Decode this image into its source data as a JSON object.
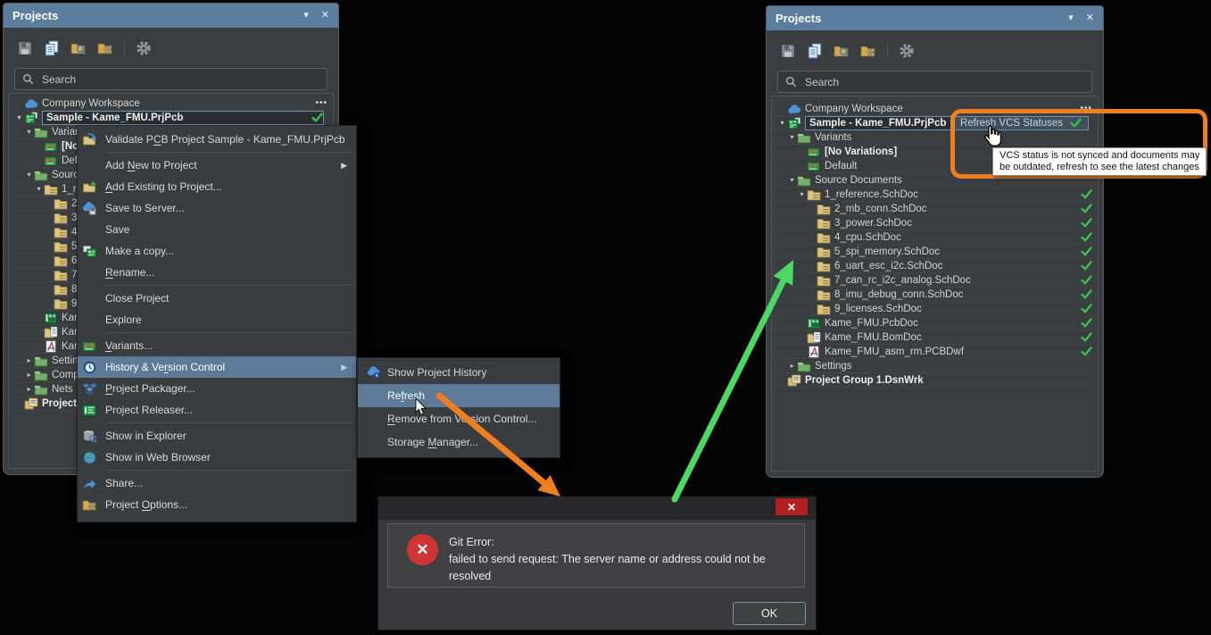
{
  "ui": {
    "collapse_glyph": "▾",
    "close_glyph": "✕",
    "submenu_arrow": "▶",
    "ellipsis": "•••",
    "tree_open": "▾",
    "tree_closed": "▸"
  },
  "colors": {
    "titlebar": "#5b7e9e",
    "panel_bg": "#3b3e40",
    "menu_highlight": "#5d7b99",
    "callout_orange": "#ee7f21",
    "arrow_green": "#4bd964",
    "check_green": "#35c24a",
    "error_red": "#cf3535"
  },
  "toolbar_icons": [
    "save",
    "copy",
    "folder-search",
    "folder-settings",
    "gear"
  ],
  "panel_left": {
    "title": "Projects",
    "search_placeholder": "Search",
    "rows": [
      {
        "label": "Company Workspace",
        "icon": "cloud",
        "indent": 0,
        "ellipsis": true
      },
      {
        "label": "Sample - Kame_FMU.PrjPcb",
        "icon": "prjpcb",
        "indent": 0,
        "expand": "open",
        "bold": true,
        "selected": true,
        "check": true
      },
      {
        "label": "Variants",
        "icon": "folder",
        "indent": 1,
        "expand": "open"
      },
      {
        "label": "[No Variations]",
        "icon": "variant",
        "indent": 2,
        "bold": true
      },
      {
        "label": "Default",
        "icon": "variant",
        "indent": 2
      },
      {
        "label": "Source Documents",
        "icon": "folder",
        "indent": 1,
        "expand": "open"
      },
      {
        "label": "1_reference.SchDoc",
        "icon": "schdoc",
        "indent": 2,
        "expand": "open",
        "check": true
      },
      {
        "label": "2_mb_conn.SchDoc",
        "icon": "schdoc",
        "indent": 3,
        "check": true
      },
      {
        "label": "3_power.SchDoc",
        "icon": "schdoc",
        "indent": 3,
        "check": true
      },
      {
        "label": "4_cpu.SchDoc",
        "icon": "schdoc",
        "indent": 3,
        "check": true
      },
      {
        "label": "5_spi_memory.SchDoc",
        "icon": "schdoc",
        "indent": 3,
        "check": true
      },
      {
        "label": "6_uart_esc_i2c.SchDoc",
        "icon": "schdoc",
        "indent": 3,
        "check": true
      },
      {
        "label": "7_can_rc_i2c_analog.SchDoc",
        "icon": "schdoc",
        "indent": 3,
        "check": true
      },
      {
        "label": "8_imu_debug_conn.SchDoc",
        "icon": "schdoc",
        "indent": 3,
        "check": true
      },
      {
        "label": "9_licenses.SchDoc",
        "icon": "schdoc",
        "indent": 3,
        "check": true
      },
      {
        "label": "Kame_FMU.PcbDoc",
        "icon": "pcbdoc",
        "indent": 2,
        "check": true
      },
      {
        "label": "Kame_FMU.BomDoc",
        "icon": "bomdoc",
        "indent": 2,
        "check": true
      },
      {
        "label": "Kame_FMU_asm_rm.PCBDwf",
        "icon": "dwf",
        "indent": 2,
        "check": true
      },
      {
        "label": "Settings",
        "icon": "folder",
        "indent": 1,
        "expand": "closed"
      },
      {
        "label": "Components",
        "icon": "folder",
        "indent": 1,
        "expand": "closed"
      },
      {
        "label": "Nets",
        "icon": "folder",
        "indent": 1,
        "expand": "closed"
      },
      {
        "label": "Project Group 1.DsnWrk",
        "icon": "group",
        "indent": 0,
        "bold": true
      }
    ]
  },
  "panel_right": {
    "title": "Projects",
    "search_placeholder": "Search",
    "refresh_button_label": "Refresh VCS Statuses",
    "rows": [
      {
        "label": "Company Workspace",
        "icon": "cloud",
        "indent": 0,
        "ellipsis": true
      },
      {
        "label": "Sample - Kame_FMU.PrjPcb",
        "icon": "prjpcb",
        "indent": 0,
        "expand": "open",
        "bold": true,
        "selected": true,
        "check": true,
        "refresh": true
      },
      {
        "label": "Variants",
        "icon": "folder",
        "indent": 1,
        "expand": "open"
      },
      {
        "label": "[No Variations]",
        "icon": "variant",
        "indent": 2,
        "bold": true
      },
      {
        "label": "Default",
        "icon": "variant",
        "indent": 2
      },
      {
        "label": "Source Documents",
        "icon": "folder",
        "indent": 1,
        "expand": "open"
      },
      {
        "label": "1_reference.SchDoc",
        "icon": "schdoc",
        "indent": 2,
        "expand": "open",
        "check": true
      },
      {
        "label": "2_mb_conn.SchDoc",
        "icon": "schdoc",
        "indent": 3,
        "check": true
      },
      {
        "label": "3_power.SchDoc",
        "icon": "schdoc",
        "indent": 3,
        "check": true
      },
      {
        "label": "4_cpu.SchDoc",
        "icon": "schdoc",
        "indent": 3,
        "check": true
      },
      {
        "label": "5_spi_memory.SchDoc",
        "icon": "schdoc",
        "indent": 3,
        "check": true
      },
      {
        "label": "6_uart_esc_i2c.SchDoc",
        "icon": "schdoc",
        "indent": 3,
        "check": true
      },
      {
        "label": "7_can_rc_i2c_analog.SchDoc",
        "icon": "schdoc",
        "indent": 3,
        "check": true
      },
      {
        "label": "8_imu_debug_conn.SchDoc",
        "icon": "schdoc",
        "indent": 3,
        "check": true
      },
      {
        "label": "9_licenses.SchDoc",
        "icon": "schdoc",
        "indent": 3,
        "check": true
      },
      {
        "label": "Kame_FMU.PcbDoc",
        "icon": "pcbdoc",
        "indent": 2,
        "check": true
      },
      {
        "label": "Kame_FMU.BomDoc",
        "icon": "bomdoc",
        "indent": 2,
        "check": true
      },
      {
        "label": "Kame_FMU_asm_rm.PCBDwf",
        "icon": "dwf",
        "indent": 2,
        "check": true
      },
      {
        "label": "Settings",
        "icon": "folder",
        "indent": 1,
        "expand": "closed"
      },
      {
        "label": "Project Group 1.DsnWrk",
        "icon": "group",
        "indent": 0,
        "bold": true
      }
    ]
  },
  "context_menu": {
    "items": [
      {
        "label": "Validate PCB Project Sample - Kame_FMU.PrjPcb",
        "icon": "validate",
        "ul": 10,
        "sep_after": true
      },
      {
        "label": "Add New to Project",
        "ul": 4,
        "submenu": true
      },
      {
        "label": "Add Existing to Project...",
        "icon": "add-existing",
        "ul": 0
      },
      {
        "label": "Save to Server...",
        "icon": "save-server",
        "ul": -1
      },
      {
        "label": "Save",
        "ul": -1
      },
      {
        "label": "Make a copy...",
        "icon": "make-copy",
        "ul": -1
      },
      {
        "label": "Rename...",
        "ul": 0,
        "sep_after": true
      },
      {
        "label": "Close Project",
        "ul": -1
      },
      {
        "label": "Explore",
        "ul": -1,
        "sep_after": true
      },
      {
        "label": "Variants...",
        "icon": "variant",
        "ul": 0
      },
      {
        "label": "History & Version Control",
        "icon": "history",
        "ul": 12,
        "submenu": true,
        "highlight": true
      },
      {
        "label": "Project Packager...",
        "icon": "packager",
        "ul": 0
      },
      {
        "label": "Project Releaser...",
        "icon": "releaser",
        "ul": -1,
        "sep_after": true
      },
      {
        "label": "Show in Explorer",
        "icon": "explorer",
        "ul": -1
      },
      {
        "label": "Show in Web Browser",
        "icon": "web",
        "ul": -1,
        "sep_after": true
      },
      {
        "label": "Share...",
        "icon": "share",
        "ul": -1
      },
      {
        "label": "Project Options...",
        "icon": "options",
        "ul": 8
      }
    ]
  },
  "submenu": {
    "items": [
      {
        "label": "Show Project History",
        "icon": "cloud-history",
        "ul": -1
      },
      {
        "label": "Refresh",
        "ul": 2,
        "highlight": true
      },
      {
        "label": "Remove from Version Control...",
        "ul": 0
      },
      {
        "label": "Storage Manager...",
        "ul": 8
      }
    ]
  },
  "dialog": {
    "close_glyph": "✕",
    "error_line1": "Git Error:",
    "error_line2": "failed to send request: The server name or address could not be resolved",
    "ok_label": "OK"
  },
  "tooltip": {
    "line1": "VCS status is not synced and documents may",
    "line2": "be outdated, refresh to see the latest changes"
  }
}
